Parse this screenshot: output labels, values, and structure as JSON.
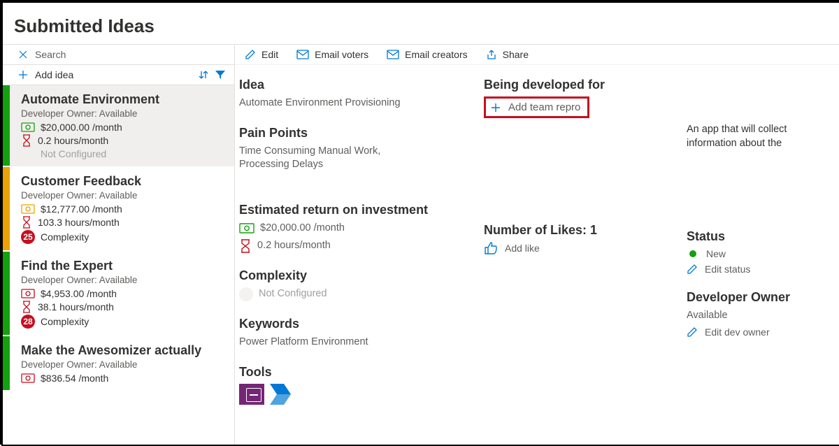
{
  "header": {
    "title": "Submitted Ideas"
  },
  "search": {
    "placeholder": "Search"
  },
  "add_row": {
    "label": "Add idea"
  },
  "toolbar": {
    "edit": "Edit",
    "email_voters": "Email voters",
    "email_creators": "Email creators",
    "share": "Share"
  },
  "ideas": [
    {
      "stripe": "green",
      "title": "Automate Environment",
      "owner": "Developer Owner: Available",
      "cost": "$20,000.00 /month",
      "hours": "0.2 hours/month",
      "complexity_label": "Not Configured",
      "complexity_badge": "",
      "cost_color": "#13a10e",
      "selected": true
    },
    {
      "stripe": "yellow",
      "title": "Customer Feedback",
      "owner": "Developer Owner: Available",
      "cost": "$12,777.00 /month",
      "hours": "103.3 hours/month",
      "complexity_label": "Complexity",
      "complexity_badge": "25",
      "cost_color": "#eaa300",
      "selected": false
    },
    {
      "stripe": "green",
      "title": "Find the Expert",
      "owner": "Developer Owner: Available",
      "cost": "$4,953.00 /month",
      "hours": "38.1 hours/month",
      "complexity_label": "Complexity",
      "complexity_badge": "28",
      "cost_color": "#c50f1f",
      "selected": false
    },
    {
      "stripe": "green",
      "title": "Make the Awesomizer actually",
      "owner": "Developer Owner: Available",
      "cost": "$836.54 /month",
      "hours": "",
      "complexity_label": "",
      "complexity_badge": "",
      "cost_color": "#c50f1f",
      "selected": false
    }
  ],
  "detail": {
    "idea_h": "Idea",
    "idea_v": "Automate Environment Provisioning",
    "pain_h": "Pain Points",
    "pain_v": "Time Consuming Manual Work, Processing Delays",
    "roi_h": "Estimated return on investment",
    "roi_cost": "$20,000.00 /month",
    "roi_hours": "0.2 hours/month",
    "complexity_h": "Complexity",
    "complexity_v": "Not Configured",
    "keywords_h": "Keywords",
    "keywords_v": "Power Platform Environment",
    "tools_h": "Tools",
    "developed_h": "Being developed for",
    "add_team_label": "Add team repro",
    "description": "An app that will collect information about the",
    "likes_h": "Number of Likes: 1",
    "add_like": "Add like",
    "status_h": "Status",
    "status_v": "New",
    "edit_status": "Edit status",
    "dev_owner_h": "Developer Owner",
    "dev_owner_v": "Available",
    "edit_dev_owner": "Edit dev owner"
  }
}
